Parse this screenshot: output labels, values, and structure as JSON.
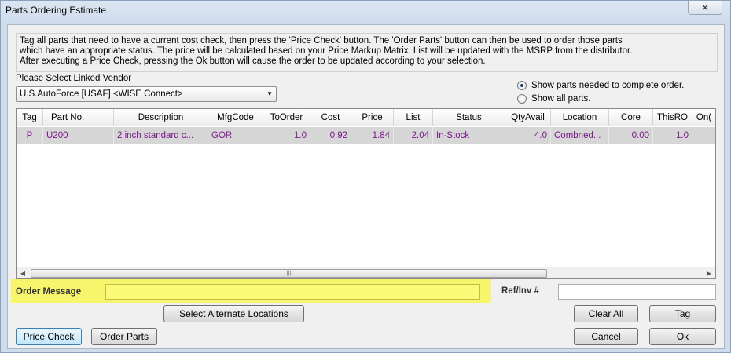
{
  "window": {
    "title": "Parts Ordering Estimate",
    "close_symbol": "✕"
  },
  "info": {
    "lines": [
      "Tag all parts that need to have a current cost check, then press the 'Price Check' button.  The 'Order Parts' button can then be used to order those parts",
      "which have an appropriate status.  The price will be calculated based on your Price Markup Matrix. List will be updated with the MSRP from the distributor.",
      "After executing a Price Check, pressing the Ok button will cause the order to be updated according to your selection."
    ]
  },
  "vendor": {
    "label": "Please Select Linked Vendor",
    "selected": "U.S.AutoForce [USAF] <WISE Connect>"
  },
  "radios": {
    "option_needed": "Show parts needed to complete order.",
    "option_all": "Show all parts.",
    "selected": "needed"
  },
  "grid": {
    "columns": [
      "Tag",
      "Part No.",
      "Description",
      "MfgCode",
      "ToOrder",
      "Cost",
      "Price",
      "List",
      "Status",
      "QtyAvail",
      "Location",
      "Core",
      "ThisRO",
      "On("
    ],
    "rows": [
      [
        "P",
        "U200",
        "2 inch standard c...",
        "GOR",
        "1.0",
        "0.92",
        "1.84",
        "2.04",
        "In-Stock",
        "4.0",
        "Combned...",
        "0.00",
        "1.0",
        ""
      ]
    ],
    "scroll_grip": "|||"
  },
  "order_message": {
    "label": "Order Message",
    "value": ""
  },
  "ref": {
    "label": "Ref/Inv #",
    "value": ""
  },
  "buttons": {
    "select_alternate": "Select Alternate Locations",
    "clear_all": "Clear All",
    "tag": "Tag",
    "price_check": "Price Check",
    "order_parts": "Order Parts",
    "cancel": "Cancel",
    "ok": "Ok"
  },
  "colors": {
    "highlight_yellow": "#f7f56b",
    "row_text": "#7a1a8a",
    "row_bg": "#d6d6d6"
  }
}
